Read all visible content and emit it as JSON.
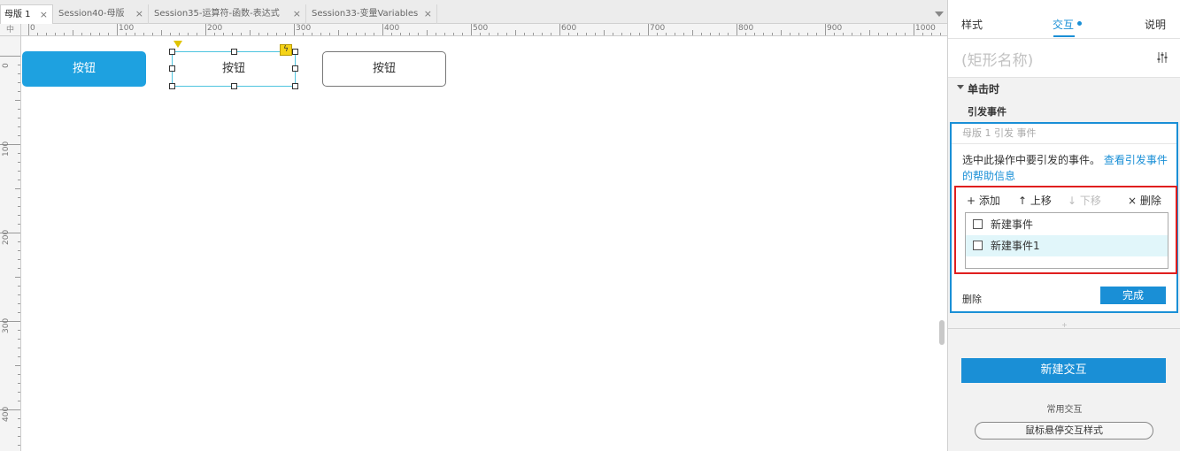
{
  "tabs": [
    {
      "label": "母版 1",
      "active": true
    },
    {
      "label": "Session40-母版",
      "active": false
    },
    {
      "label": "Session35-运算符-函数-表达式",
      "active": false
    },
    {
      "label": "Session33-变量Variables",
      "active": false
    }
  ],
  "tab_close_glyph": "×",
  "ruler": {
    "corner_label": "中",
    "h_labels": [
      "0",
      "100",
      "200",
      "300",
      "400",
      "500",
      "600",
      "700",
      "800",
      "900",
      "1000"
    ],
    "v_labels": [
      "0",
      "100",
      "200",
      "300",
      "400"
    ]
  },
  "canvas": {
    "button_primary_label": "按钮",
    "button_selected_label": "按钮",
    "button_outline_label": "按钮",
    "lightning_glyph": "ϟ"
  },
  "panel": {
    "tabs": {
      "style": "样式",
      "interaction": "交互",
      "notes": "说明"
    },
    "shape_name_placeholder": "(矩形名称)",
    "event_title": "单击时",
    "action_title": "引发事件",
    "action_box": {
      "subtitle": "母版 1 引发 事件",
      "desc_text": "选中此操作中要引发的事件。",
      "desc_link": "查看引发事件的帮助信息",
      "toolbar": {
        "add": "+ 添加",
        "up": "↑ 上移",
        "down": "↓ 下移",
        "delete": "× 删除"
      },
      "events": [
        {
          "label": "新建事件",
          "checked": false,
          "highlighted": false
        },
        {
          "label": "新建事件1",
          "checked": false,
          "highlighted": true
        }
      ],
      "delete_label": "删除",
      "done_label": "完成"
    },
    "split_glyph": "+",
    "new_interaction_label": "新建交互",
    "common_title": "常用交互",
    "hover_style_label": "鼠标悬停交互样式"
  },
  "colors": {
    "accent": "#1a8fd6",
    "primary_button": "#1ea1e0",
    "highlight_box": "#e01f1f",
    "selection_row": "#e1f6fa"
  }
}
